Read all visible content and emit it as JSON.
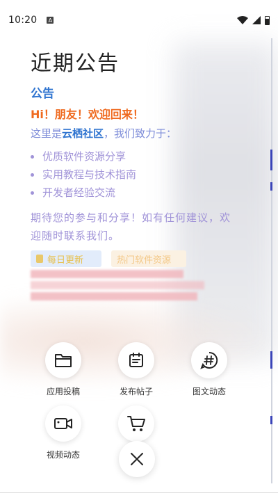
{
  "status_bar": {
    "time": "10:20",
    "notification_badge": "A"
  },
  "announcement": {
    "title": "近期公告",
    "heading": "公告",
    "greeting": "Hi！朋友！欢迎回来！",
    "intro_prefix": "这里是",
    "intro_brand": "云栖社区",
    "intro_suffix": "，我们致力于：",
    "bullets": [
      "优质软件资源分享",
      "实用教程与技术指南",
      "开发者经验交流"
    ],
    "closing": "期待您的参与和分享！如有任何建议，欢迎随时联系我们。",
    "tags": [
      "每日更新",
      "热门软件资源"
    ]
  },
  "actions": {
    "app_submit": "应用投稿",
    "post": "发布帖子",
    "image_text": "图文动态",
    "video": "视频动态"
  },
  "icons": {
    "app_submit": "folder-icon",
    "post": "calendar-icon",
    "image_text": "hashtag-icon",
    "video": "video-camera-icon",
    "shop": "shopping-cart-icon",
    "close": "close-icon"
  },
  "colors": {
    "heading_blue": "#2f74d0",
    "greeting_orange": "#ef6a1f",
    "text_purple": "#a093d8"
  }
}
